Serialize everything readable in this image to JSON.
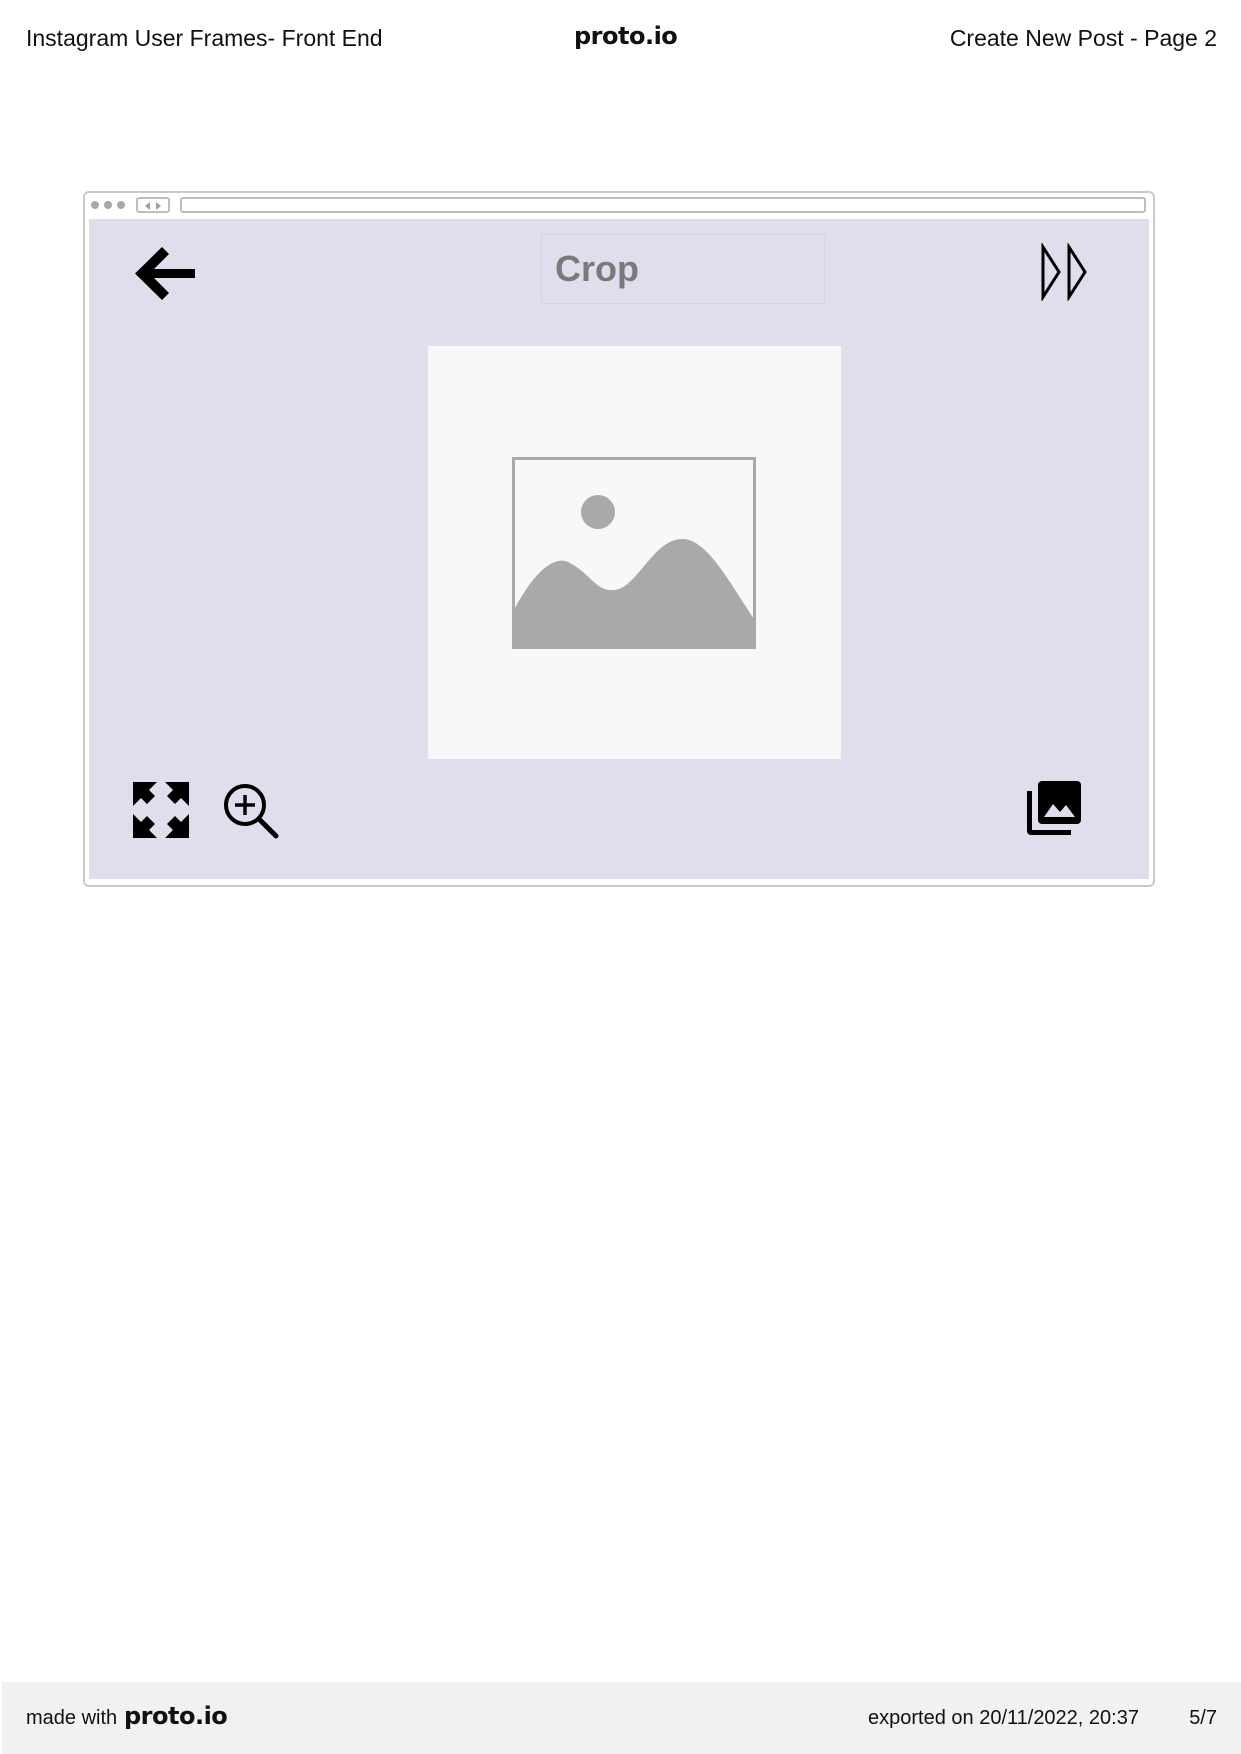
{
  "page_header": {
    "project_title": "Instagram User Frames- Front End",
    "brand": "proto.io",
    "screen_title": "Create New Post - Page 2"
  },
  "app_screen": {
    "background_color": "#e1dded",
    "title": "Crop",
    "icons": {
      "back": "arrow-left-icon",
      "next": "double-triangle-right-icon",
      "image": "image-placeholder-icon",
      "expand": "expand-arrows-icon",
      "zoom": "zoom-in-icon",
      "gallery": "photo-library-icon"
    }
  },
  "page_footer": {
    "made_with": "made with",
    "brand": "proto.io",
    "exported": "exported on 20/11/2022, 20:37",
    "page_number": "5/7"
  }
}
